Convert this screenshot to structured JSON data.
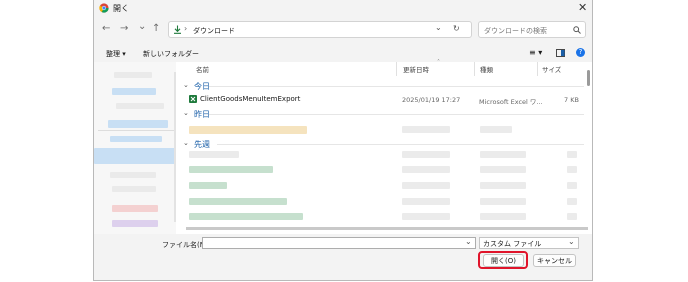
{
  "window": {
    "title": "開く",
    "close_glyph": "✕"
  },
  "nav": {
    "back": "←",
    "forward": "→",
    "recent": "⌄",
    "up": "↑",
    "breadcrumb_sep": "›",
    "path": "ダウンロード",
    "dropdown": "⌄",
    "refresh": "↻",
    "search_placeholder": "ダウンロードの検索"
  },
  "toolbar": {
    "organize": "整理 ▾",
    "new_folder": "新しいフォルダー",
    "view_glyph": "≡ ▾",
    "help": "?"
  },
  "columns": {
    "name": "名前",
    "modified": "更新日時",
    "type": "種類",
    "size": "サイズ"
  },
  "groups": {
    "today": "今日",
    "yesterday": "昨日",
    "last_week": "先週"
  },
  "files": [
    {
      "name": "ClientGoodsMenuItemExport",
      "modified": "2025/01/19 17:27",
      "type": "Microsoft Excel ワ...",
      "size": "7 KB"
    }
  ],
  "bottom": {
    "filename_label": "ファイル名(N):",
    "filename_value": "",
    "filetype_value": "カスタム ファイル",
    "open_button": "開く(O)",
    "cancel_button": "キャンセル"
  },
  "colors": {
    "highlight": "#e0142b",
    "accent": "#1a5fa8"
  }
}
